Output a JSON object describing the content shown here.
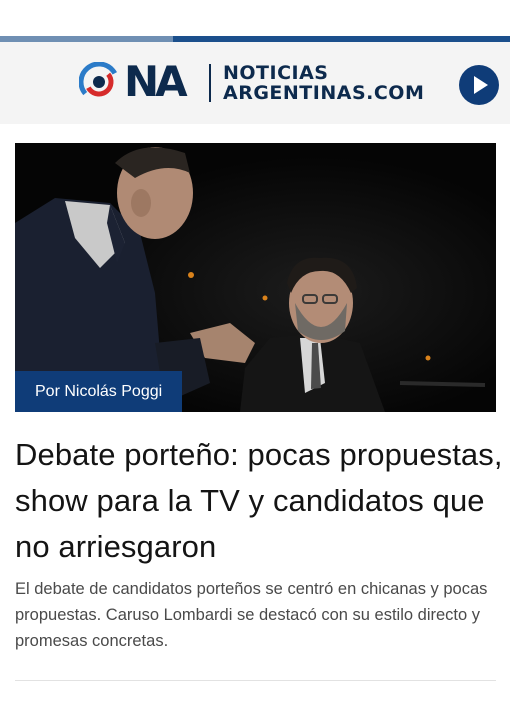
{
  "header": {
    "logo_mark": "NA",
    "logo_line1": "NOTICIAS",
    "logo_line2": "ARGENTINAS.COM",
    "play_icon": "play-icon",
    "progress_fraction": 0.34,
    "brand_color": "#0f3c78"
  },
  "article": {
    "byline": "Por Nicolás Poggi",
    "headline": "Debate porteño: pocas propuestas, show para la TV y candidatos que no arriesgaron",
    "summary": "El debate de candidatos porteños se centró en chicanas y pocas propuestas. Caruso Lombardi se destacó con su estilo directo y promesas concretas."
  }
}
